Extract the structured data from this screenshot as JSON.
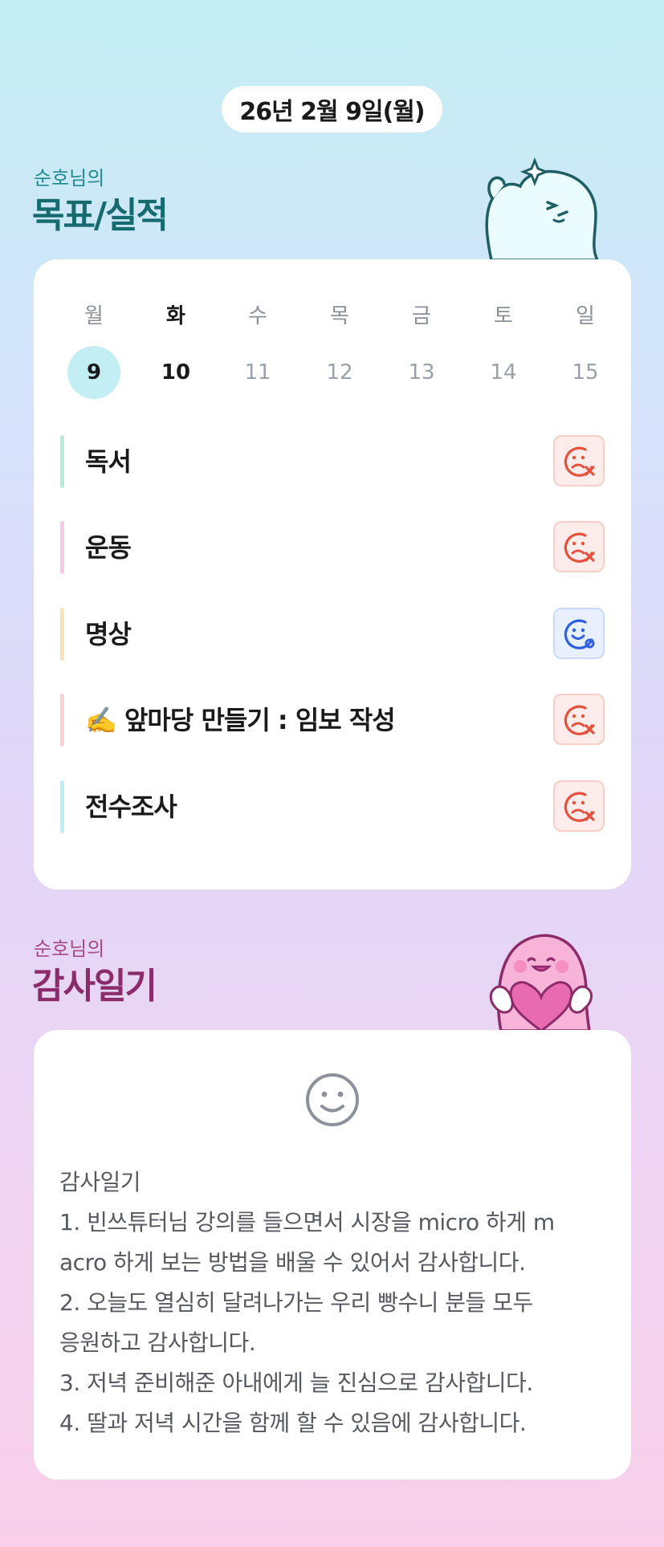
{
  "date_pill": "26년 2월 9일(월)",
  "goals_section": {
    "subtitle": "순호님의",
    "title": "목표/실적",
    "days": [
      {
        "dow": "월",
        "num": "9",
        "selected": true
      },
      {
        "dow": "화",
        "num": "10",
        "today": true
      },
      {
        "dow": "수",
        "num": "11"
      },
      {
        "dow": "목",
        "num": "12"
      },
      {
        "dow": "금",
        "num": "13"
      },
      {
        "dow": "토",
        "num": "14"
      },
      {
        "dow": "일",
        "num": "15"
      }
    ],
    "goals": [
      {
        "label": "독서",
        "bar_color": "#b9ebd9",
        "status": "fail",
        "icon": "sad-face-x-icon"
      },
      {
        "label": "운동",
        "bar_color": "#f7c9e6",
        "status": "fail",
        "icon": "sad-face-x-icon"
      },
      {
        "label": "명상",
        "bar_color": "#fbe2b8",
        "status": "done",
        "icon": "happy-face-check-icon"
      },
      {
        "label": "✍️ 앞마당 만들기 : 임보 작성",
        "bar_color": "#f9d0d3",
        "status": "fail",
        "icon": "sad-face-x-icon"
      },
      {
        "label": "전수조사",
        "bar_color": "#bfeef3",
        "status": "fail",
        "icon": "sad-face-x-icon"
      }
    ]
  },
  "gratitude_section": {
    "subtitle": "순호님의",
    "title": "감사일기",
    "icon": "smile-face-icon",
    "lines": [
      "감사일기",
      "1. 빈쓰튜터님 강의를 들으면서 시장을 micro 하게 m",
      "acro 하게 보는 방법을 배울 수 있어서 감사합니다.",
      "2. 오늘도 열심히 달려나가는 우리 빵수니 분들 모두",
      "응원하고 감사합니다.",
      "3. 저녁 준비해준 아내에게 늘 진심으로 감사합니다.",
      "4. 딸과 저녁 시간을 함께 할 수 있음에 감사합니다."
    ]
  },
  "colors": {
    "fail_icon": "#e5513c",
    "done_icon": "#2f5fe0",
    "teal_title": "#166b6f",
    "pink_title": "#8c2b6a"
  }
}
